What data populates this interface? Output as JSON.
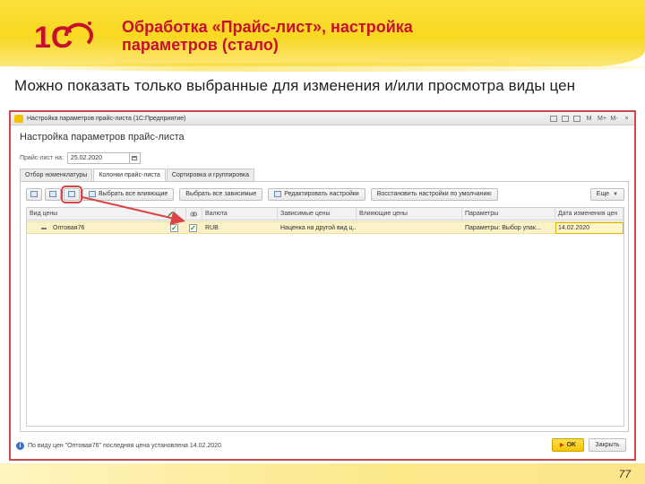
{
  "slide": {
    "title_line1": "Обработка «Прайс-лист», настройка",
    "title_line2": "параметров (стало)",
    "subtitle": "Можно показать только выбранные для изменения и/или просмотра виды цен",
    "page_number": "77",
    "logo_text": "1С"
  },
  "window": {
    "title": "Настройка параметров прайс-листа (1С:Предприятие)",
    "controls": [
      "M",
      "M+",
      "M-",
      "×"
    ]
  },
  "form": {
    "title": "Настройка параметров прайс-листа",
    "date_label": "Прайс-лист на:",
    "date_value": "25.02.2020"
  },
  "tabs": [
    {
      "label": "Отбор номенклатуры",
      "active": false
    },
    {
      "label": "Колонки прайс-листа",
      "active": true
    },
    {
      "label": "Сортировка и группировка",
      "active": false
    }
  ],
  "toolbar": {
    "select_all_influencing": "Выбрать все влияющие",
    "select_all_dependent": "Выбрать все зависимые",
    "edit_settings": "Редактировать настройки",
    "restore_defaults": "Восстановить настройки по умолчанию",
    "more": "Еще"
  },
  "table": {
    "headers": [
      "Вид цены",
      "",
      "",
      "Валюта",
      "Зависимые цены",
      "Влияющие цены",
      "Параметры",
      "Дата изменения цен"
    ],
    "rows": [
      {
        "price_type": "Оптовая76",
        "checked1": true,
        "checked2": true,
        "currency": "RUB",
        "dependent": "Наценка на другой вид ц...",
        "influencing": "",
        "parameters": "Параметры: Выбор упак...",
        "changed": "14.02.2020"
      }
    ]
  },
  "status": {
    "text": "По виду цен \"Оптовая76\" последняя цена установлена 14.02.2020."
  },
  "buttons": {
    "ok": "OK",
    "close": "Закрыть"
  },
  "colors": {
    "title_red": "#c8102e",
    "highlight_red": "#d94545",
    "accent_yellow": "#f9d821"
  }
}
